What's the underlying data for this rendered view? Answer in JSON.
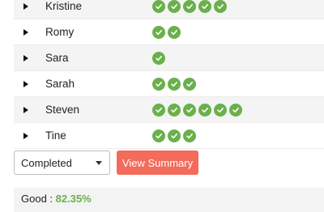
{
  "colors": {
    "check_green": "#6ab04c",
    "button_bg": "#f26b5b",
    "good_green": "#6ab04c"
  },
  "check_icon": "check-circle-icon",
  "rows": [
    {
      "name": "Kristine",
      "checks": 5
    },
    {
      "name": "Romy",
      "checks": 2
    },
    {
      "name": "Sara",
      "checks": 1
    },
    {
      "name": "Sarah",
      "checks": 3
    },
    {
      "name": "Steven",
      "checks": 6
    },
    {
      "name": "Tine",
      "checks": 3
    }
  ],
  "filter": {
    "selected": "Completed"
  },
  "view_summary_label": "View Summary",
  "summary": {
    "label": "Good : ",
    "percent": "82.35%"
  }
}
